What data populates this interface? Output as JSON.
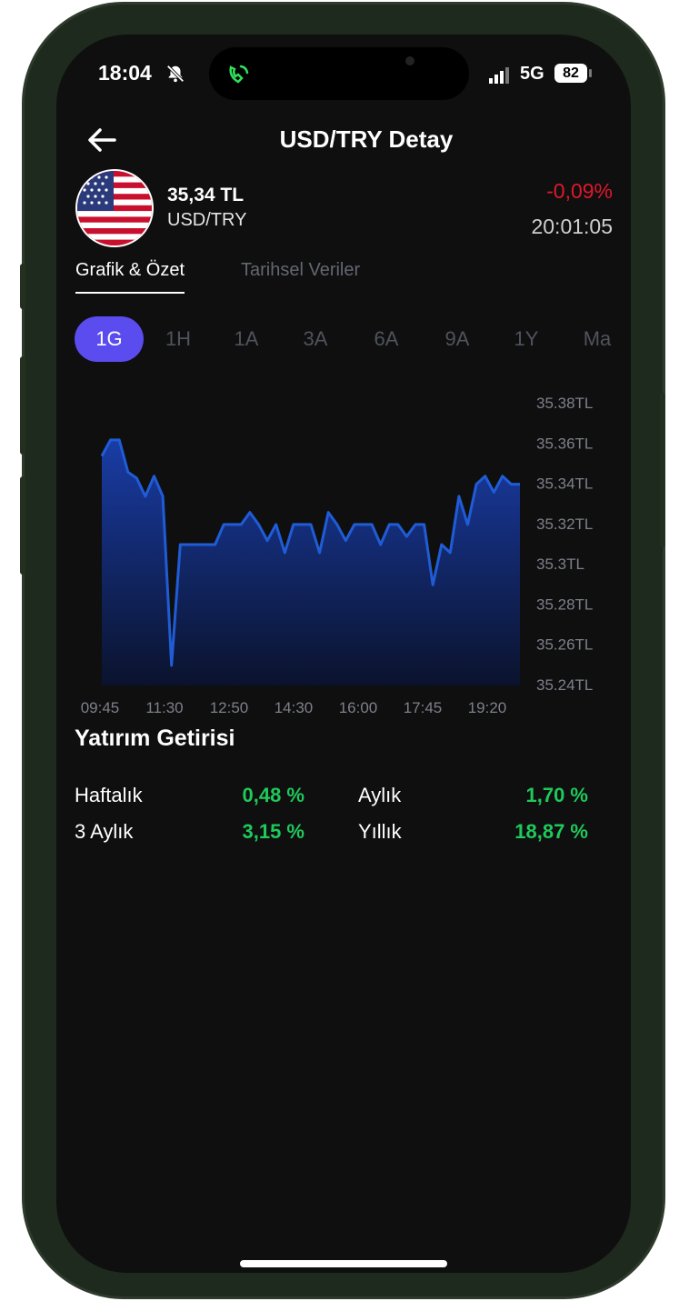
{
  "status_bar": {
    "time": "18:04",
    "network": "5G",
    "battery": "82"
  },
  "nav": {
    "title": "USD/TRY Detay"
  },
  "header": {
    "price": "35,34 TL",
    "pair": "USD/TRY",
    "change": "-0,09%",
    "update_time": "20:01:05"
  },
  "tabs": [
    {
      "label": "Grafik & Özet"
    },
    {
      "label": "Tarihsel Veriler"
    }
  ],
  "ranges": [
    "1G",
    "1H",
    "1A",
    "3A",
    "6A",
    "9A",
    "1Y",
    "Ma"
  ],
  "selected_range": "1G",
  "chart_data": {
    "type": "area",
    "x_labels": [
      "09:45",
      "11:30",
      "12:50",
      "14:30",
      "16:00",
      "17:45",
      "19:20"
    ],
    "y_ticks": [
      "35.38TL",
      "35.36TL",
      "35.34TL",
      "35.32TL",
      "35.3TL",
      "35.28TL",
      "35.26TL",
      "35.24TL"
    ],
    "ylim": [
      35.24,
      35.38
    ],
    "values": [
      35.354,
      35.362,
      35.362,
      35.346,
      35.343,
      35.334,
      35.344,
      35.334,
      35.25,
      35.31,
      35.31,
      35.31,
      35.31,
      35.31,
      35.32,
      35.32,
      35.32,
      35.326,
      35.32,
      35.312,
      35.32,
      35.306,
      35.32,
      35.32,
      35.32,
      35.306,
      35.326,
      35.32,
      35.312,
      35.32,
      35.32,
      35.32,
      35.31,
      35.32,
      35.32,
      35.314,
      35.32,
      35.32,
      35.29,
      35.31,
      35.306,
      35.334,
      35.32,
      35.34,
      35.344,
      35.336,
      35.344,
      35.34,
      35.34
    ],
    "line_color": "#1f5cd6",
    "grid": false
  },
  "returns": {
    "title": "Yatırım Getirisi",
    "items": [
      {
        "label": "Haftalık",
        "value": "0,48 %"
      },
      {
        "label": "Aylık",
        "value": "1,70 %"
      },
      {
        "label": "3 Aylık",
        "value": "3,15 %"
      },
      {
        "label": "Yıllık",
        "value": "18,87 %"
      }
    ]
  },
  "colors": {
    "accent": "#5b4cf0",
    "negative": "#e0182b",
    "positive": "#1fc95a",
    "background": "#0f0f10"
  }
}
